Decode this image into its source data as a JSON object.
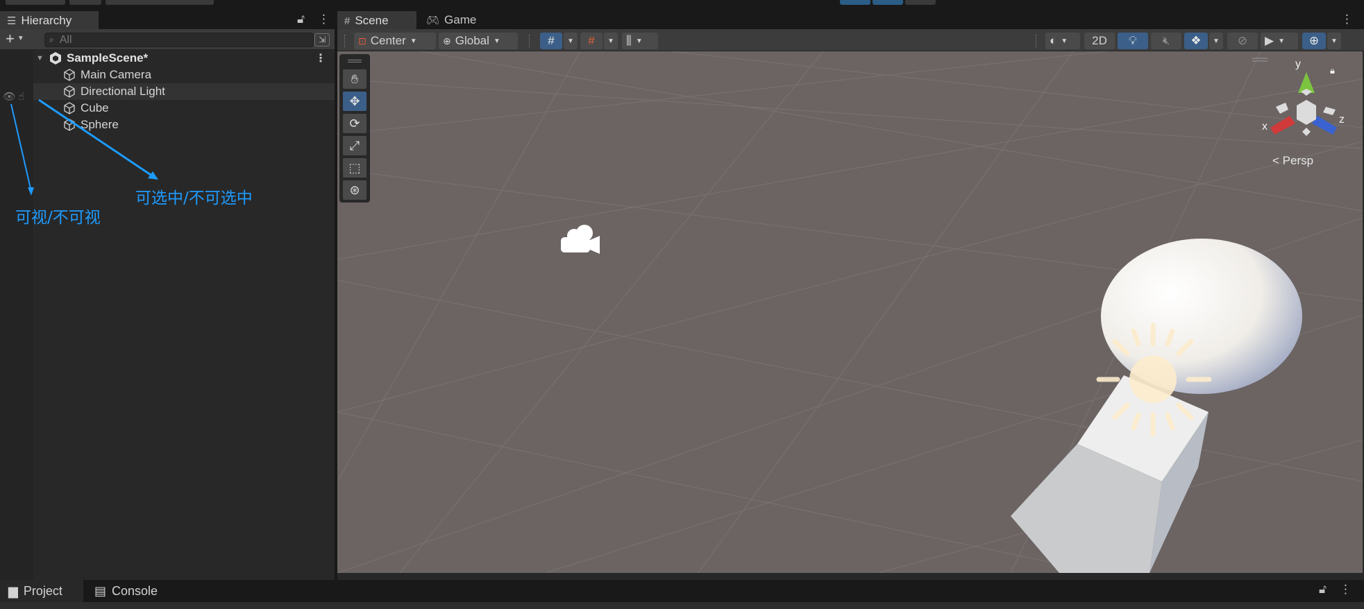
{
  "hierarchy": {
    "tab_label": "Hierarchy",
    "add_label": "+",
    "search_placeholder": "All",
    "scene_name": "SampleScene*",
    "items": [
      {
        "label": "Main Camera"
      },
      {
        "label": "Directional Light"
      },
      {
        "label": "Cube"
      },
      {
        "label": "Sphere"
      }
    ]
  },
  "annotations": {
    "visibility": "可视/不可视",
    "pickability": "可选中/不可选中"
  },
  "scene": {
    "tabs": [
      {
        "label": "Scene"
      },
      {
        "label": "Game"
      }
    ],
    "pivot_mode": "Center",
    "pivot_rotation": "Global",
    "mode_2d": "2D",
    "projection": "Persp",
    "axes": {
      "x": "x",
      "y": "y",
      "z": "z"
    }
  },
  "bottom": {
    "tabs": [
      {
        "label": "Project"
      },
      {
        "label": "Console"
      }
    ]
  },
  "colors": {
    "accent_blue": "#3b5f88",
    "annotation_blue": "#1e9bff",
    "viewport_bg": "#6b6463",
    "gizmo_x": "#d03a3a",
    "gizmo_y": "#7cc43f",
    "gizmo_z": "#3a62d0"
  }
}
